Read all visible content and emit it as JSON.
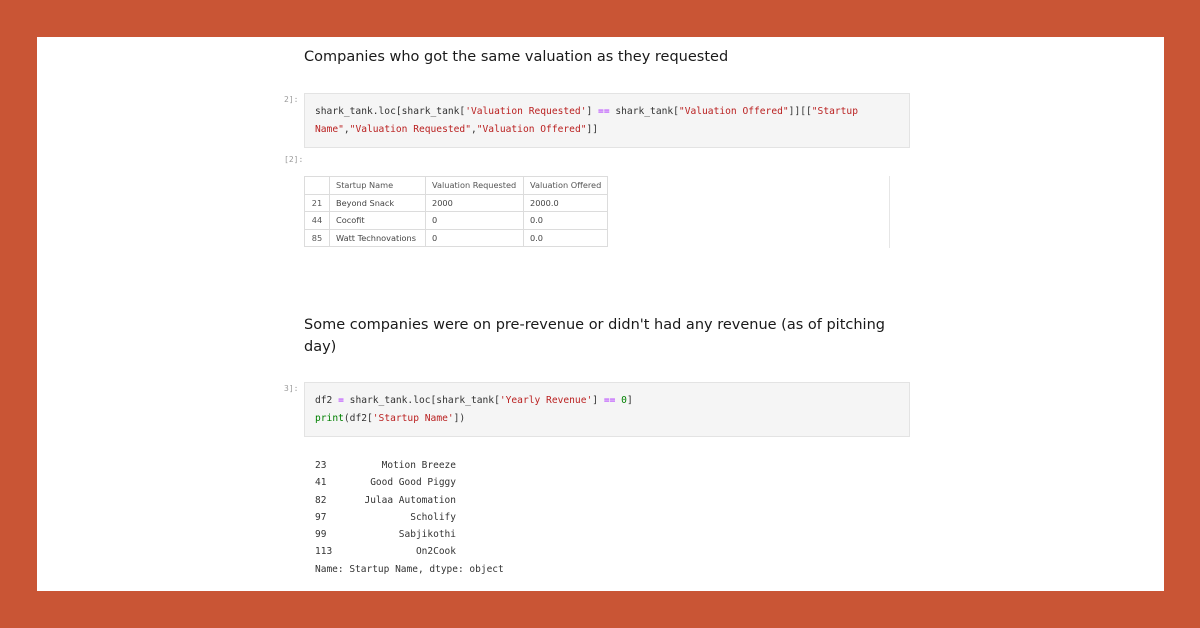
{
  "section1": {
    "heading": "Companies who got the same valuation as they requested",
    "in_prompt": "2]:",
    "out_prompt": "[2]:",
    "code": {
      "t1": "shark_tank.loc[shark_tank[",
      "s1": "'Valuation Requested'",
      "t2": "] ",
      "op": "==",
      "t3": " shark_tank[",
      "s2": "\"Valuation Offered\"",
      "t4": "]][[",
      "s3": "\"Startup Name\"",
      "t5": ",",
      "s4": "\"Valuation Requested\"",
      "t6": ",",
      "s5": "\"Valuation Offered\"",
      "t7": "]]"
    },
    "table": {
      "columns": [
        "",
        "Startup Name",
        "Valuation Requested",
        "Valuation Offered"
      ],
      "rows": [
        [
          "21",
          "Beyond Snack",
          "2000",
          "2000.0"
        ],
        [
          "44",
          "Cocofit",
          "0",
          "0.0"
        ],
        [
          "85",
          "Watt Technovations",
          "0",
          "0.0"
        ]
      ]
    }
  },
  "section2": {
    "heading": "Some companies were on pre-revenue or didn't had any revenue (as of pitching day)",
    "in_prompt": "3]:",
    "code": {
      "t1": "df2 ",
      "op1": "=",
      "t2": " shark_tank.loc[shark_tank[",
      "s1": "'Yearly Revenue'",
      "t3": "] ",
      "op2": "==",
      "t4": " ",
      "n1": "0",
      "t5": "]",
      "fn": "print",
      "t6": "(df2[",
      "s2": "'Startup Name'",
      "t7": "])"
    },
    "output": {
      "rows": [
        {
          "index": "23",
          "name": "Motion Breeze"
        },
        {
          "index": "41",
          "name": "Good Good Piggy"
        },
        {
          "index": "82",
          "name": "Julaa Automation"
        },
        {
          "index": "97",
          "name": "Scholify"
        },
        {
          "index": "99",
          "name": "Sabjikothi"
        },
        {
          "index": "113",
          "name": "On2Cook"
        }
      ],
      "footer": "Name: Startup Name, dtype: object"
    }
  }
}
